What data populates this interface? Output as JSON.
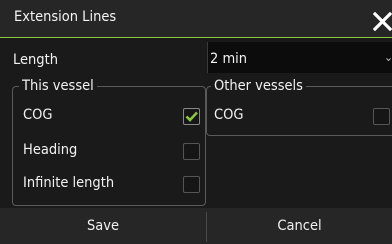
{
  "dialog": {
    "title": "Extension Lines",
    "close_icon": "close-x-icon",
    "accent_color": "#8cc63f"
  },
  "length": {
    "label": "Length",
    "value": "2 min",
    "arrow_icon": "dropdown-arrow-icon"
  },
  "this_vessel": {
    "legend": "This vessel",
    "items": [
      {
        "label": "COG",
        "checked": true
      },
      {
        "label": "Heading",
        "checked": false
      },
      {
        "label": "Infinite length",
        "checked": false
      }
    ]
  },
  "other_vessels": {
    "legend": "Other vessels",
    "items": [
      {
        "label": "COG",
        "checked": false
      }
    ]
  },
  "footer": {
    "save_label": "Save",
    "cancel_label": "Cancel"
  }
}
